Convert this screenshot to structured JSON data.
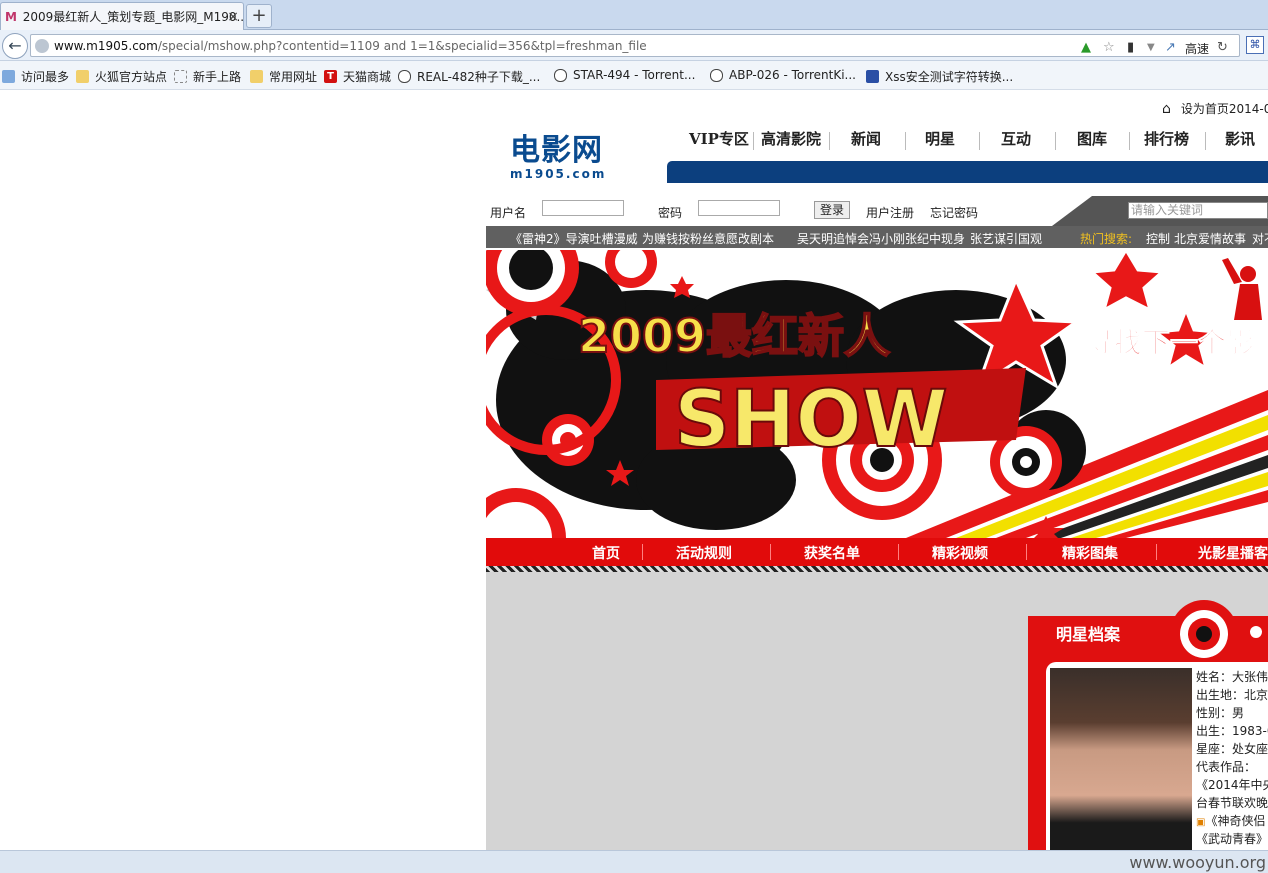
{
  "browser": {
    "tab_title": "2009最红新人_策划专题_电影网_M190...",
    "tab_favicon": "M",
    "new_tab": "+",
    "url_host": "www.m1905.com",
    "url_path": "/special/mshow.php?contentid=1109 and 1=1&specialid=356&tpl=freshman_file",
    "speed_label": "高速",
    "bookmarks": [
      "访问最多",
      "火狐官方站点",
      "新手上路",
      "常用网址",
      "天猫商城",
      "REAL-482种子下载_...",
      "STAR-494 - Torrent...",
      "ABP-026 - TorrentKi...",
      "Xss安全测试字符转换..."
    ]
  },
  "site": {
    "set_home": "设为首页2014-0",
    "logo_main": "电影网",
    "logo_sub": "m1905.com",
    "nav": [
      "VIP专区",
      "高清影院",
      "新闻",
      "明星",
      "互动",
      "图库",
      "排行榜",
      "影讯"
    ],
    "login": {
      "username_label": "用户名",
      "password_label": "密码",
      "login_button": "登录",
      "register": "用户注册",
      "forgot": "忘记密码"
    },
    "search_placeholder": "请输入关键词",
    "news": [
      "《雷神2》导演吐槽漫威",
      "为赚钱按粉丝意愿改剧本",
      "吴天明追悼会冯小刚张纪中现身",
      "张艺谋引国观"
    ],
    "hot_label": "热门搜索:",
    "hot_items": [
      "控制",
      "北京爱情故事",
      "对不"
    ],
    "banner_title": "2009最红新人",
    "banner_show": "SHOW",
    "banner_slogan": "寻找下一个影",
    "menu": [
      "首页",
      "活动规则",
      "获奖名单",
      "精彩视频",
      "精彩图集",
      "光影星播客"
    ],
    "card": {
      "title": "明星档案",
      "lines": [
        "姓名：大张伟",
        "出生地：北京",
        "性别：男",
        "出生：1983-0",
        "星座：处女座",
        "代表作品：",
        "《2014年中央",
        "台春节联欢晚",
        "《神奇侠侣",
        "《武动青春》"
      ]
    }
  },
  "watermark": "www.wooyun.org",
  "colors": {
    "brand_blue": "#0a4b8f",
    "menu_red": "#e10b0b",
    "nav_blue": "#0c3f7e"
  }
}
